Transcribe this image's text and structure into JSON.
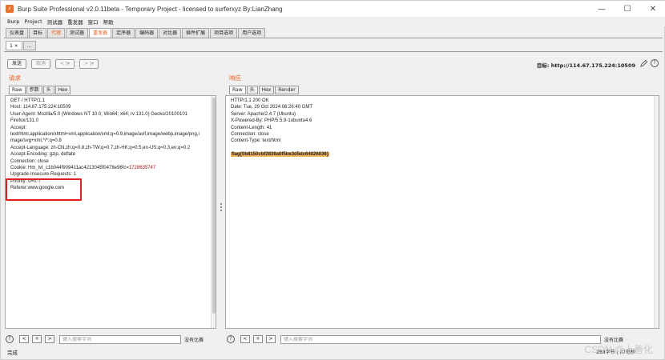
{
  "window": {
    "title": "Burp Suite Professional v2.0.11beta - Temporary Project - licensed to surferxyz By:LianZhang",
    "controls": {
      "minimize": "—",
      "maximize": "☐",
      "close": "✕"
    }
  },
  "menu": [
    "Burp",
    "Project",
    "测试器",
    "重发器",
    "窗口",
    "帮助"
  ],
  "main_tabs": [
    "仪表盘",
    "目标",
    "代理",
    "测试器",
    "重发器",
    "定序器",
    "编码器",
    "对比器",
    "插件扩展",
    "项目选项",
    "用户选项"
  ],
  "main_tabs_active": 4,
  "sub_tabs": [
    "1 ×",
    "..."
  ],
  "toolbar": {
    "send": "发送",
    "cancel": "取消",
    "back": "< |▾",
    "forward": "> |▾"
  },
  "target": "目标: http://114.67.175.224:10509",
  "request": {
    "title": "请求",
    "tabs": [
      "Raw",
      "参数",
      "头",
      "Hex"
    ],
    "lines": [
      "GET / HTTP/1.1",
      "Host: 114.67.175.224:10509",
      "User-Agent: Mozilla/5.0 (Windows NT 10.0; Win64; x64; rv:131.0) Gecko/20100101",
      "Firefox/131.0",
      "Accept:",
      "text/html,application/xhtml+xml,application/xml;q=0.9,image/avif,image/webp,image/png,i",
      "mage/svg+xml,*/*;q=0.8",
      "Accept-Language: zh-CN,zh;q=0.8,zh-TW;q=0.7,zh-HK;q=0.5,en-US;q=0.3,en;q=0.2",
      "Accept-Encoding: gzip, deflate",
      "Connection: close"
    ],
    "cookie_key": "Cookie: Hm_lvt_c1b044f909411ac4213045f0478e96fc=",
    "cookie_value": "1728635747",
    "lines_after": [
      "Upgrade-Insecure-Requests: 1",
      "Priority: u=0, i",
      "Referer:www.google.com"
    ],
    "search_placeholder": "键入搜索字词",
    "matches": "没有比赛"
  },
  "response": {
    "title": "响应",
    "tabs": [
      "Raw",
      "头",
      "Hex",
      "Render"
    ],
    "lines": [
      "HTTP/1.1 200 OK",
      "Date: Tue, 29 Oct 2024 06:26:40 GMT",
      "Server: Apache/2.4.7 (Ubuntu)",
      "X-Powered-By: PHP/5.5.9-1ubuntu4.6",
      "Content-Length: 41",
      "Connection: close",
      "Content-Type: text/html"
    ],
    "flag": "flag{0b8150cbf2839a0f5be3d5dc64026036}",
    "search_placeholder": "键入搜索字词",
    "matches": "没有比赛"
  },
  "nav_buttons": [
    "<",
    "+",
    ">"
  ],
  "help": "?",
  "status": "完成",
  "status_right": "288字节 | 87毫秒",
  "watermark": "CSDN @上善化"
}
